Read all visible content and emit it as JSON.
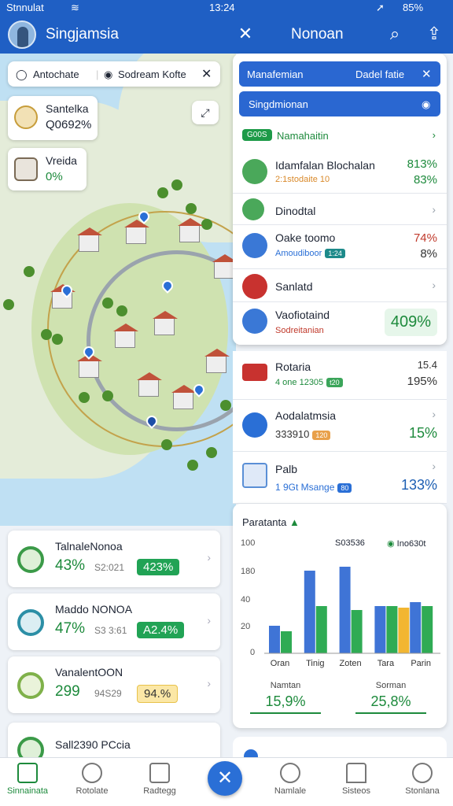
{
  "status_bar": {
    "carrier": "Stnnulat",
    "time": "13:24",
    "battery": "85%"
  },
  "app_bar": {
    "title": "Singjamsia",
    "secondary_title": "Nonoan"
  },
  "search_bar": {
    "left_text": "Antochate",
    "right_text": "Sodream Kofte"
  },
  "map_cards": [
    {
      "title": "Santelka",
      "value": "Q0692%"
    },
    {
      "title": "Vreida",
      "value": "0%"
    }
  ],
  "panel": {
    "header1": "Manafemian",
    "header1_right": "Dadel fatie",
    "header2": "Singdmionan",
    "filter_pill": "G00S",
    "filter_label": "Namahaitin"
  },
  "rows": [
    {
      "name": "Idamfalan Blochalan",
      "sub": "2:1stodaite 10",
      "pct": "813%",
      "pct2": "83%",
      "pct_color": "#1d8a3c",
      "icon_color": "#4aa85a"
    },
    {
      "name": "Dinodtal",
      "sub": "",
      "pct": "",
      "pct2": "",
      "pct_color": "#1d8a3c",
      "icon_color": "#4aa85a"
    },
    {
      "name": "Oake toomo",
      "sub": "Amoudiboor",
      "tag": "1:24",
      "pct": "74%",
      "pct2": "8%",
      "pct_color": "#c0392b",
      "icon_color": "#3a78d6"
    },
    {
      "name": "Sanlatd",
      "sub": "",
      "pct": "",
      "pct2": "",
      "pct_color": "#1d8a3c",
      "icon_color": "#c8322f"
    },
    {
      "name": "Vaofiotaind",
      "sub": "Sodreitanian",
      "pct": "409%",
      "pct2": "",
      "pct_color": "#1d8a3c",
      "icon_color": "#3a78d6"
    },
    {
      "name": "Rotaria",
      "sub": "4 one 12305",
      "tag": "t20",
      "pct": "15.4",
      "pct2": "195%",
      "pct_color": "#333",
      "icon_color": "#c8322f"
    },
    {
      "name": "Aodalatmsia",
      "sub": "333910",
      "tag": "120",
      "pct": "",
      "pct2": "15%",
      "pct_color": "#1d8a3c",
      "icon_color": "#2a6fd6"
    },
    {
      "name": "Palb",
      "sub": "1 9Gt Msange",
      "tag": "80",
      "pct": "",
      "pct2": "133%",
      "pct_color": "#1d5fb3",
      "icon_color": "#5a8fd6"
    }
  ],
  "chart_card": {
    "title": "Paratanta",
    "legend_left": "S03536",
    "legend_right": "Ino630t",
    "stat_left_label": "Namtan",
    "stat_left_value": "15,9%",
    "stat_right_label": "Sorman",
    "stat_right_value": "25,8%"
  },
  "chart_data": {
    "type": "bar",
    "categories": [
      "Oran",
      "Tinig",
      "Zoten",
      "Tara",
      "Parin"
    ],
    "series": [
      {
        "values": [
          35,
          105,
          110,
          60,
          65
        ],
        "color": "#3f74d6"
      },
      {
        "values": [
          28,
          60,
          55,
          60,
          60
        ],
        "color": "#2fab54"
      },
      {
        "values": [
          0,
          0,
          0,
          58,
          0
        ],
        "color": "#f2b632"
      }
    ],
    "ylim": [
      0,
      100
    ],
    "yticks": [
      "100",
      "180",
      "40",
      "20",
      "0"
    ]
  },
  "left_cards": [
    {
      "title": "TalnaleNonoa",
      "value": "43%",
      "small": "S2:021",
      "badge": "423%",
      "badge_bg": "#21a355",
      "badge_fg": "#ffffff",
      "icon_color": "#3b9a48"
    },
    {
      "title": "Maddo NONOA",
      "value": "47%",
      "small": "S3 3:61",
      "badge": "A2.4%",
      "badge_bg": "#21a355",
      "badge_fg": "#ffffff",
      "icon_color": "#2c8fa6"
    },
    {
      "title": "VanalentOON",
      "value": "299",
      "small": "94S29",
      "badge": "94.%",
      "badge_bg": "#fbe7a6",
      "badge_fg": "#333333",
      "icon_color": "#7fb14a"
    },
    {
      "title": "Sall2390 PCcia",
      "value": "",
      "small": "",
      "badge": "",
      "badge_bg": "#ffffff",
      "badge_fg": "#333333",
      "icon_color": "#3b9a48"
    }
  ],
  "bottom_nav": [
    {
      "label": "Sinnainata"
    },
    {
      "label": "Rotolate"
    },
    {
      "label": "Radtegg"
    },
    {
      "label": "Namlale"
    },
    {
      "label": "Sisteos"
    },
    {
      "label": "Stonlana"
    }
  ]
}
